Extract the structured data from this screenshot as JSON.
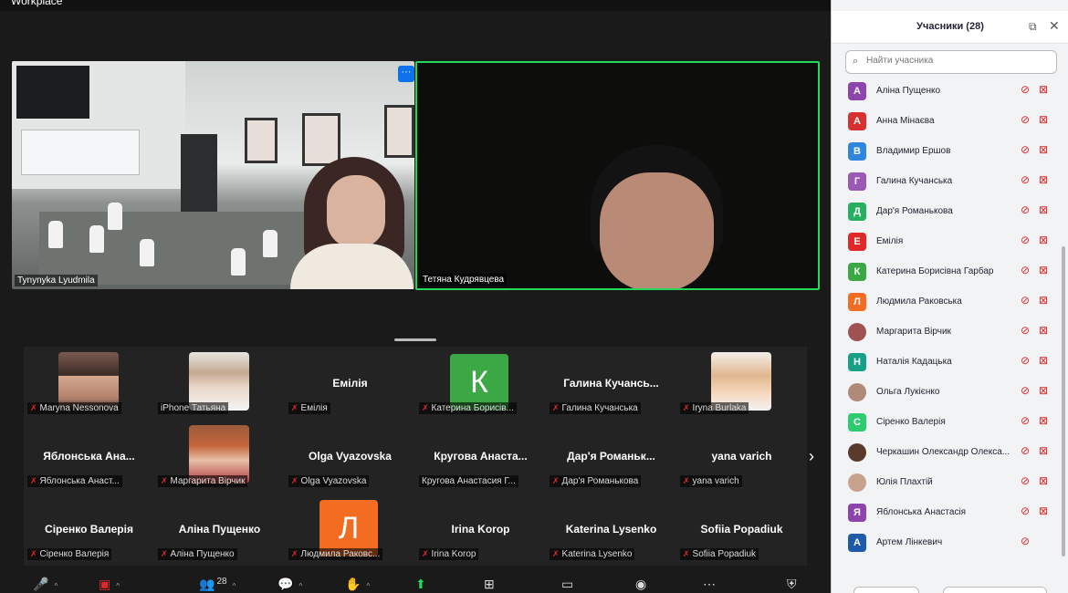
{
  "window": {
    "title": "Workplace"
  },
  "videos": [
    {
      "name": "Tynynyka Lyudmila"
    },
    {
      "name": "Тетяна Кудрявцева"
    }
  ],
  "gallery": {
    "tiles": [
      {
        "display": "",
        "label": "Maryna Nessonova",
        "muted": true,
        "photo": true
      },
      {
        "display": "",
        "label": "iPhone Татьяна",
        "muted": false,
        "photo": true
      },
      {
        "display": "Емілія",
        "label": "Емілія",
        "muted": true
      },
      {
        "display": "К",
        "label": "Катерина Борисів...",
        "muted": true,
        "color": "#3ba845",
        "letter": true
      },
      {
        "display": "Галина Кучансь...",
        "label": "Галина Кучанська",
        "muted": true
      },
      {
        "display": "",
        "label": "Iryna Burlaka",
        "muted": true,
        "photo": true
      },
      {
        "display": "Яблонська Ана...",
        "label": "Яблонська Анаст...",
        "muted": true
      },
      {
        "display": "",
        "label": "Маргарита Вірчик",
        "muted": true,
        "photo": true
      },
      {
        "display": "Olga Vyazovska",
        "label": "Olga Vyazovska",
        "muted": true
      },
      {
        "display": "Кругова Анаста...",
        "label": "Кругова Анастасия Г...",
        "muted": false
      },
      {
        "display": "Дар'я Романьк...",
        "label": "Дар'я Романькова",
        "muted": true
      },
      {
        "display": "yana varich",
        "label": "yana varich",
        "muted": true
      },
      {
        "display": "Сіренко Валерія",
        "label": "Сіренко Валерія",
        "muted": true
      },
      {
        "display": "Аліна Пущенко",
        "label": "Аліна Пущенко",
        "muted": true
      },
      {
        "display": "Л",
        "label": "Людмила Раковс...",
        "muted": true,
        "color": "#f26d21",
        "letter": true
      },
      {
        "display": "Irina Korop",
        "label": "Irina Korop",
        "muted": true
      },
      {
        "display": "Katerina Lysenko",
        "label": "Katerina Lysenko",
        "muted": true
      },
      {
        "display": "Sofiia Popadiuk",
        "label": "Sofiia Popadiuk",
        "muted": true
      }
    ]
  },
  "toolbar": {
    "participants_count": "28"
  },
  "panel": {
    "title": "Учасники (28)",
    "search_placeholder": "Найти учасника",
    "participants": [
      {
        "initial": "А",
        "color": "#8e44ad",
        "name": "Аліна Пущенко",
        "cam_off": true
      },
      {
        "initial": "А",
        "color": "#d63031",
        "name": "Анна Мінаєва",
        "cam_off": true
      },
      {
        "initial": "В",
        "color": "#2e86de",
        "name": "Владимир Ершов",
        "cam_off": true
      },
      {
        "initial": "Г",
        "color": "#9b59b6",
        "name": "Галина Кучанська",
        "cam_off": true
      },
      {
        "initial": "Д",
        "color": "#27ae60",
        "name": "Дар'я Романькова",
        "cam_off": true
      },
      {
        "initial": "Е",
        "color": "#e02828",
        "name": "Емілія",
        "cam_off": true
      },
      {
        "initial": "К",
        "color": "#3ba845",
        "name": "Катерина Борисівна Гарбар",
        "cam_off": true
      },
      {
        "initial": "Л",
        "color": "#f26d21",
        "name": "Людмила Раковська",
        "cam_off": true
      },
      {
        "initial": "",
        "color": "#a05252",
        "name": "Маргарита Вірчик",
        "cam_off": true
      },
      {
        "initial": "Н",
        "color": "#16a085",
        "name": "Наталія Кадацька",
        "cam_off": true
      },
      {
        "initial": "",
        "color": "#b08a78",
        "name": "Ольга Лукієнко",
        "cam_off": true
      },
      {
        "initial": "С",
        "color": "#2ecc71",
        "name": "Сіренко Валерія",
        "cam_off": true
      },
      {
        "initial": "",
        "color": "#5a3a2a",
        "name": "Черкашин Олександр Олекса...",
        "cam_off": true
      },
      {
        "initial": "",
        "color": "#c9a28d",
        "name": "Юлія Плахтій",
        "cam_off": true
      },
      {
        "initial": "Я",
        "color": "#8e44ad",
        "name": "Яблонська Анастасія",
        "cam_off": true
      },
      {
        "initial": "А",
        "color": "#1e5aa8",
        "name": "Артем Лінкевич",
        "cam_off": false
      }
    ]
  },
  "colors": {
    "active_speaker": "#23d959",
    "muted": "#e02828",
    "accent": "#0e72ed"
  }
}
